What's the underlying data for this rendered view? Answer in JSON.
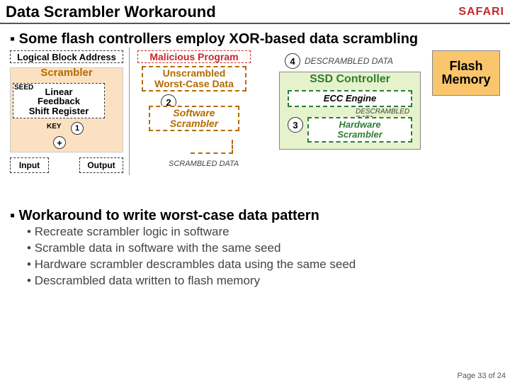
{
  "header": {
    "title": "Data Scrambler Workaround",
    "logo": "SAFARI"
  },
  "h1": "Some flash controllers employ XOR-based data scrambling",
  "diagram": {
    "lba": "Logical Block Address",
    "scrambler": "Scrambler",
    "lfsr": "Linear\nFeedback\nShift Register",
    "seed": "SEED",
    "key": "KEY",
    "step1": "1",
    "xor": "+",
    "input": "Input",
    "output": "Output",
    "mal_prog": "Malicious Program",
    "worst": "Unscrambled\nWorst-Case Data",
    "step2": "2",
    "sw_scrambler": "Software\nScrambler",
    "scrambled": "SCRAMBLED DATA",
    "step4": "4",
    "descrambled": "DESCRAMBLED DATA",
    "ssd": "SSD Controller",
    "ecc": "ECC Engine",
    "descr2": "DESCRAMBLED\nDATA",
    "step3": "3",
    "hw_scrambler": "Hardware\nScrambler",
    "flash": "Flash\nMemory"
  },
  "h2": "Workaround to write worst-case data pattern",
  "bullets": [
    "Recreate scrambler logic in software",
    "Scramble data in software with the same seed",
    "Hardware scrambler descrambles data using the same seed",
    "Descrambled data written to flash memory"
  ],
  "footer": "Page 33 of 24"
}
